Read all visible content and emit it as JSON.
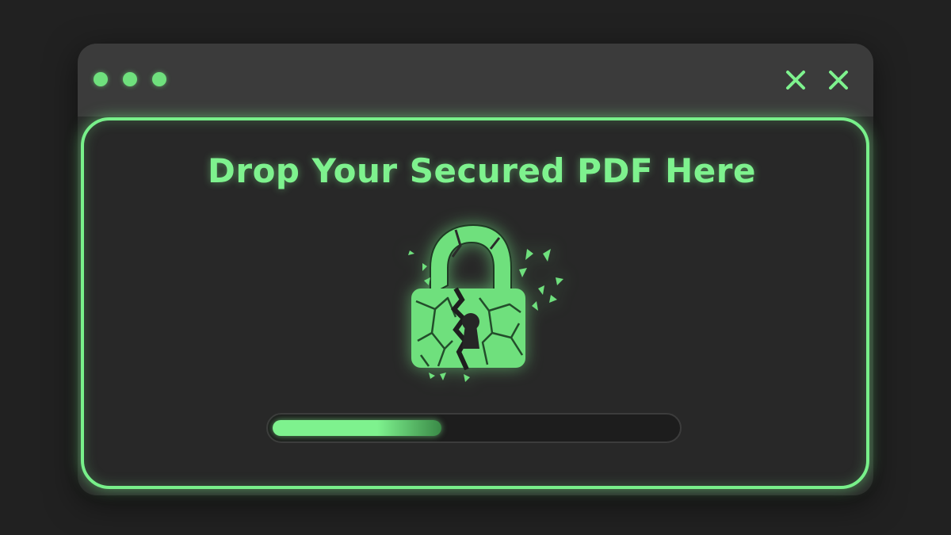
{
  "window": {
    "title_bar_dots": [
      "dot-1",
      "dot-2",
      "dot-3"
    ],
    "controls": [
      {
        "name": "close-icon-1",
        "glyph": "x-icon"
      },
      {
        "name": "close-icon-2",
        "glyph": "x-icon"
      }
    ]
  },
  "drop_zone": {
    "title": "Drop Your Secured PDF Here",
    "icon": "broken-padlock-icon"
  },
  "progress": {
    "value": 0.42
  },
  "colors": {
    "background": "#212121",
    "window": "#2a2a2a",
    "titlebar": "#3b3b3b",
    "accent": "#7ef28e",
    "accent_dark": "#3a8a47"
  }
}
